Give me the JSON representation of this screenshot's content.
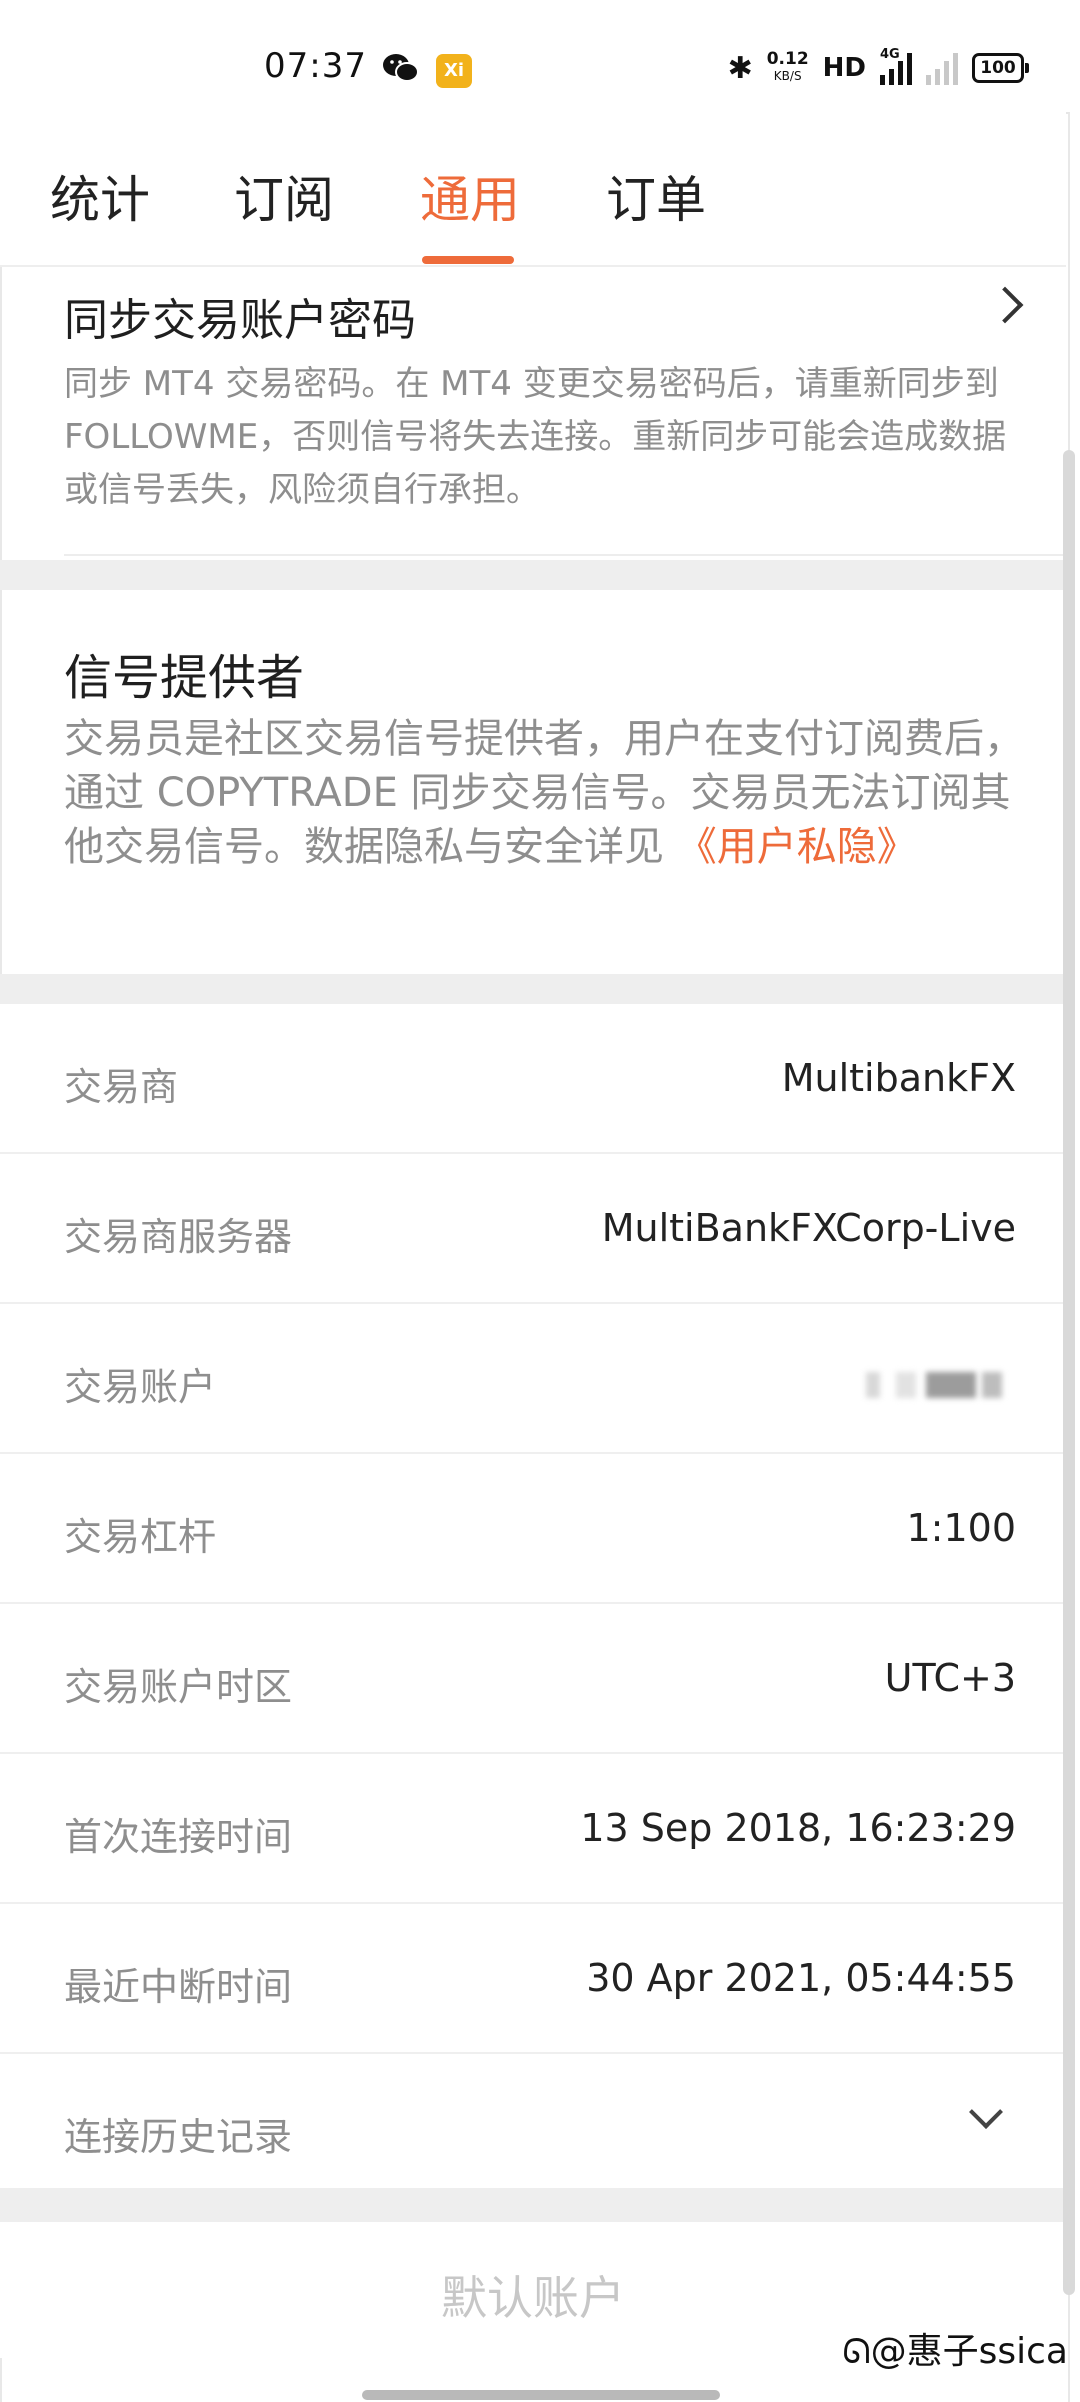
{
  "status_bar": {
    "time": "07:37",
    "speed_value": "0.12",
    "speed_unit": "KB/S",
    "hd": "HD",
    "network": "4G",
    "battery": "100",
    "app_badge": "Xi"
  },
  "tabs": [
    {
      "label": "统计"
    },
    {
      "label": "订阅"
    },
    {
      "label": "通用"
    },
    {
      "label": "订单"
    }
  ],
  "sync_password": {
    "title": "同步交易账户密码",
    "description": "同步 MT4 交易密码。在 MT4 变更交易密码后，请重新同步到 FOLLOWME，否则信号将失去连接。重新同步可能会造成数据或信号丢失，风险须自行承担。"
  },
  "signal_provider": {
    "title": "信号提供者",
    "description": "交易员是社区交易信号提供者，用户在支付订阅费后，通过 COPYTRADE 同步交易信号。交易员无法订阅其他交易信号。数据隐私与安全详见 ",
    "link": "《用户私隐》"
  },
  "info_rows": {
    "broker": {
      "label": "交易商",
      "value": "MultibankFX"
    },
    "server": {
      "label": "交易商服务器",
      "value": "MultiBankFXCorp-Live"
    },
    "account": {
      "label": "交易账户"
    },
    "leverage": {
      "label": "交易杠杆",
      "value": "1:100"
    },
    "timezone": {
      "label": "交易账户时区",
      "value": "UTC+3"
    },
    "first_connect": {
      "label": "首次连接时间",
      "value": "13 Sep 2018, 16:23:29"
    },
    "last_disconnect": {
      "label": "最近中断时间",
      "value": "30 Apr 2021, 05:44:55"
    },
    "history": {
      "label": "连接历史记录"
    }
  },
  "default_account_button": "默认账户",
  "watermark": "@惠子ssica",
  "colors": {
    "accent": "#ee6b3a",
    "muted_text": "#8e8e8e",
    "divider": "#eeeeee"
  }
}
